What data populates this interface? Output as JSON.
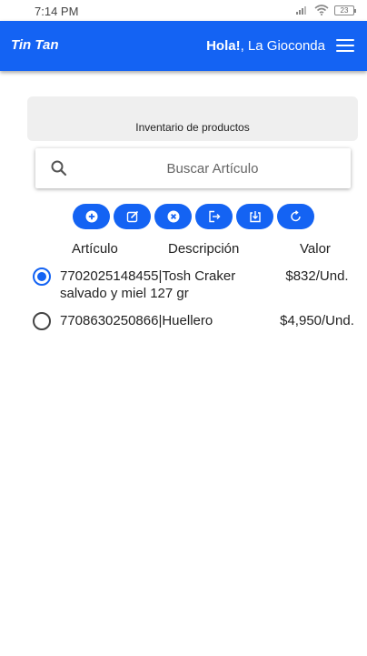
{
  "status_bar": {
    "time": "7:14 PM",
    "battery": "23"
  },
  "app_bar": {
    "brand": "Tin Tan",
    "greeting_bold": "Hola!",
    "greeting_rest": ", La Gioconda"
  },
  "header": {
    "title": "Inventario de productos"
  },
  "search": {
    "placeholder": "Buscar Artículo",
    "value": ""
  },
  "toolbar": {
    "buttons": [
      "add",
      "edit",
      "delete",
      "export",
      "download",
      "refresh"
    ]
  },
  "table": {
    "columns": [
      "Artículo",
      "Descripción",
      "Valor"
    ],
    "rows": [
      {
        "name": "7702025148455|Tosh Craker salvado y miel 127 gr",
        "price": "$832/Und.",
        "selected": true
      },
      {
        "name": "7708630250866|Huellero",
        "price": "$4,950/Und.",
        "selected": false
      }
    ]
  },
  "colors": {
    "primary": "#1463f3",
    "card": "#efefef"
  }
}
